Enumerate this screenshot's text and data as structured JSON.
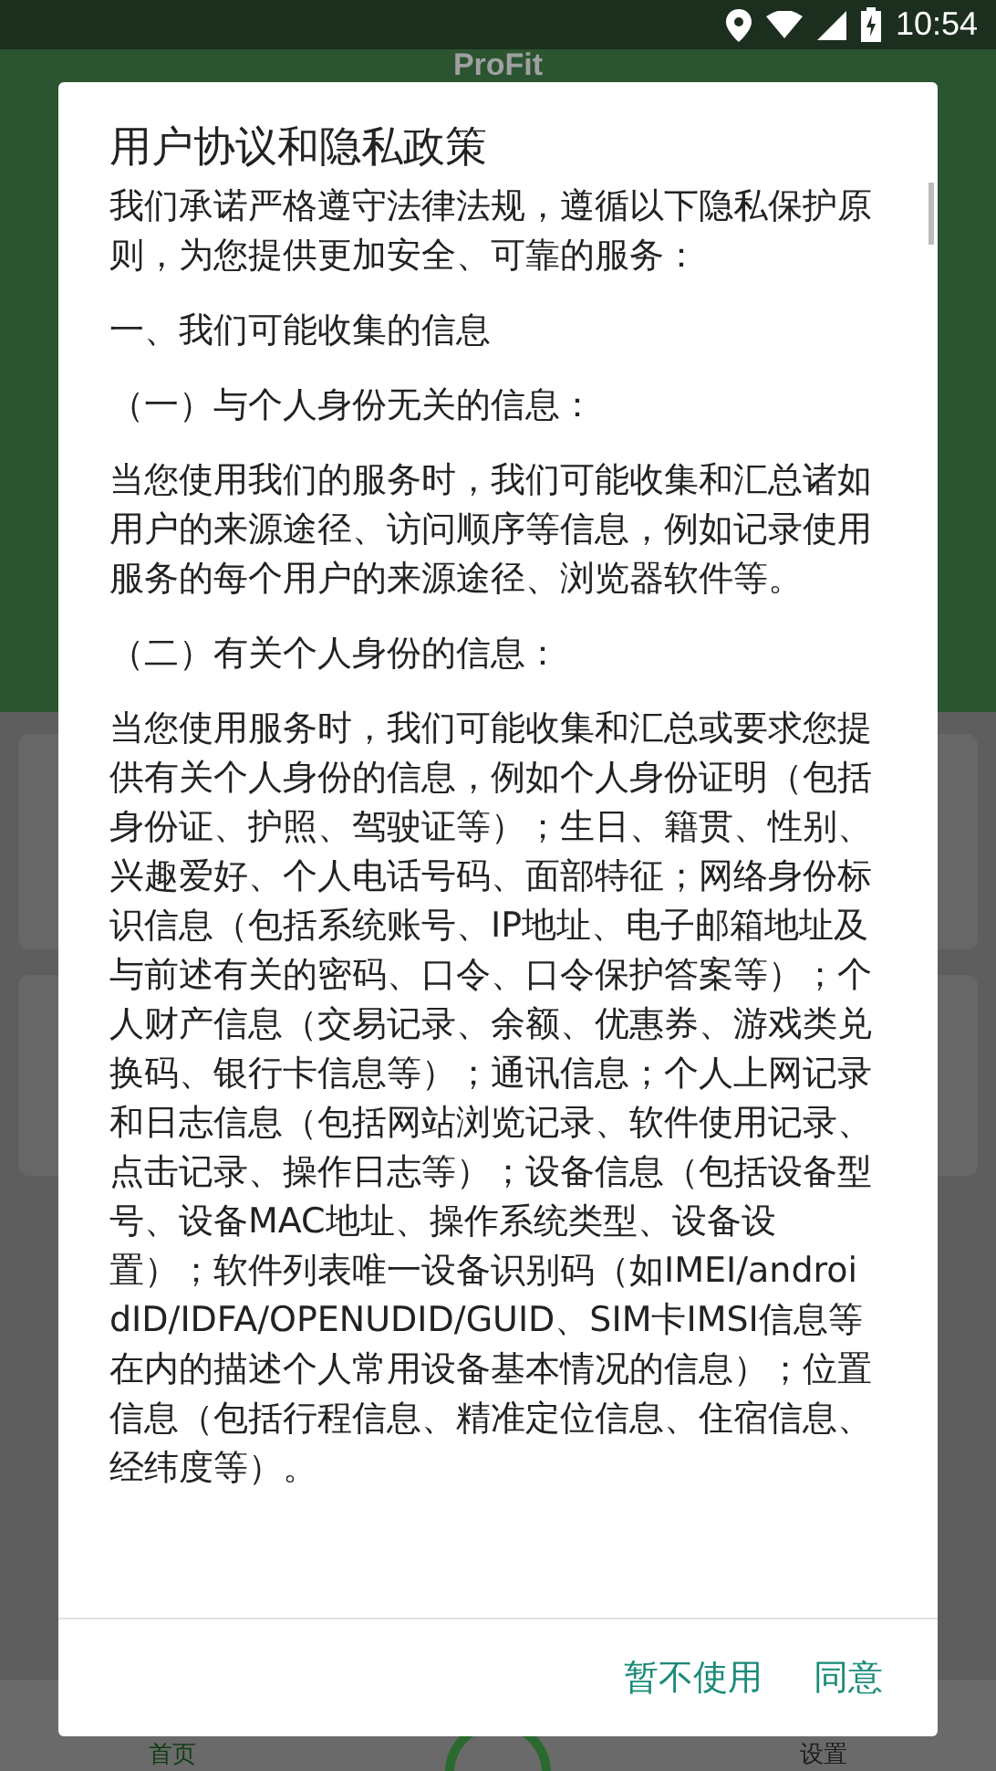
{
  "status_bar": {
    "time": "10:54"
  },
  "app": {
    "title": "ProFit",
    "nav_items": [
      {
        "label": "首页",
        "selected": true
      },
      {
        "label": "设置",
        "selected": false
      }
    ]
  },
  "dialog": {
    "title": "用户协议和隐私政策",
    "paragraphs": [
      "我们承诺严格遵守法律法规，遵循以下隐私保护原则，为您提供更加安全、可靠的服务：",
      "一、我们可能收集的信息",
      "（一）与个人身份无关的信息：",
      "当您使用我们的服务时，我们可能收集和汇总诸如用户的来源途径、访问顺序等信息，例如记录使用服务的每个用户的来源途径、浏览器软件等。",
      "（二）有关个人身份的信息：",
      "当您使用服务时，我们可能收集和汇总或要求您提供有关个人身份的信息，例如个人身份证明（包括身份证、护照、驾驶证等）；生日、籍贯、性别、兴趣爱好、个人电话号码、面部特征；网络身份标识信息（包括系统账号、IP地址、电子邮箱地址及与前述有关的密码、口令、口令保护答案等）；个人财产信息（交易记录、余额、优惠券、游戏类兑换码、银行卡信息等）；通讯信息；个人上网记录和日志信息（包括网站浏览记录、软件使用记录、点击记录、操作日志等）；设备信息（包括设备型号、设备MAC地址、操作系统类型、设备设置）；软件列表唯一设备识别码（如IMEI/androidID/IDFA/OPENUDID/GUID、SIM卡IMSI信息等在内的描述个人常用设备基本情况的信息）；位置信息（包括行程信息、精准定位信息、住宿信息、经纬度等）。"
    ],
    "buttons": [
      "暂不使用",
      "同意"
    ]
  }
}
